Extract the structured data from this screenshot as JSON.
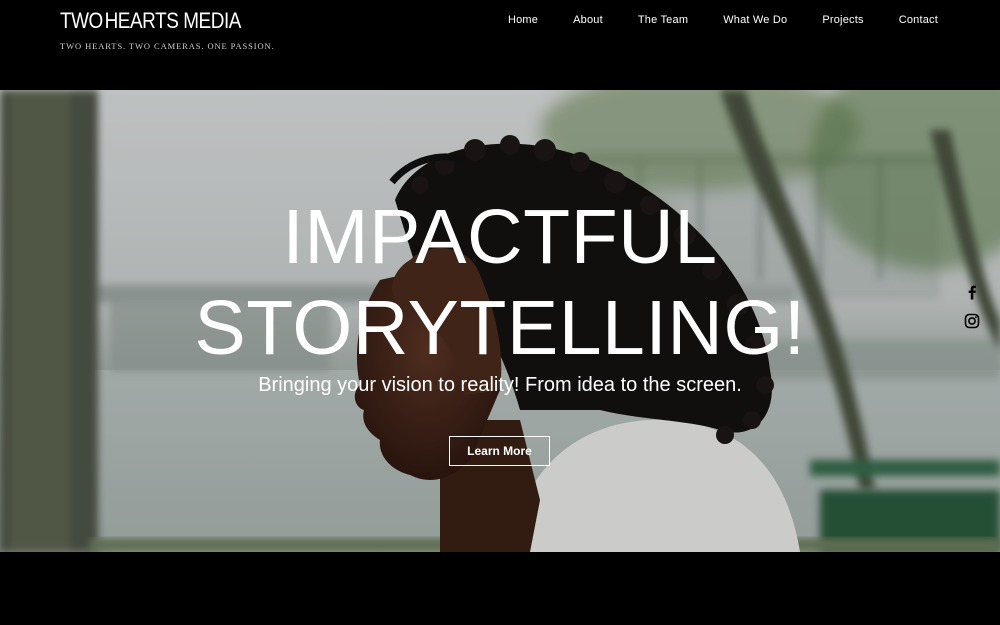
{
  "brand": {
    "logo_word_left": "TWO",
    "logo_word_right": "HEARTS MEDIA",
    "tagline": "TWO HEARTS. TWO CAMERAS. ONE PASSION."
  },
  "nav": {
    "items": [
      {
        "label": "Home"
      },
      {
        "label": "About"
      },
      {
        "label": "The Team"
      },
      {
        "label": "What We Do"
      },
      {
        "label": "Projects"
      },
      {
        "label": "Contact"
      }
    ]
  },
  "hero": {
    "headline_line1": "IMPACTFUL",
    "headline_line2": "STORYTELLING!",
    "subheadline": "Bringing your vision to reality! From idea to the screen.",
    "cta_label": "Learn More"
  },
  "social": {
    "icons": [
      "facebook-icon",
      "instagram-icon"
    ]
  },
  "colors": {
    "background": "#000000",
    "text": "#ffffff"
  }
}
